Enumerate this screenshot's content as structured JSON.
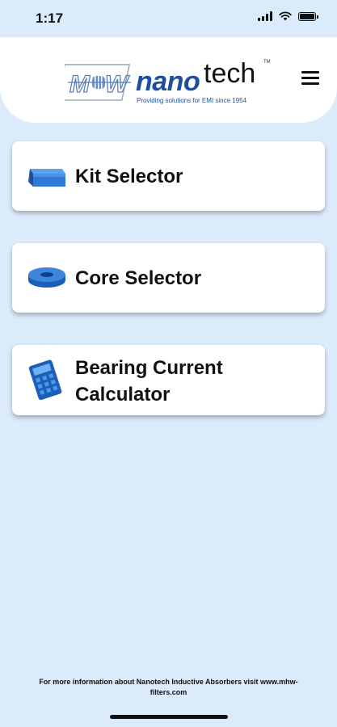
{
  "status_bar": {
    "time": "1:17"
  },
  "header": {
    "logo_mark": "M-H-W",
    "logo_nano": "nano",
    "logo_tech": "tech",
    "logo_tm": "TM",
    "tagline": "Providing solutions for EMI since 1954",
    "menu_icon": "hamburger-icon"
  },
  "buttons": [
    {
      "label": "Kit Selector",
      "icon": "kit-box-icon"
    },
    {
      "label": "Core Selector",
      "icon": "toroid-core-icon"
    },
    {
      "label_line1": "Bearing Current",
      "label_line2": "Calculator",
      "icon": "calculator-icon"
    }
  ],
  "footer": {
    "line1": "For more information about Nanotech Inductive Absorbers visit www.mhw-",
    "line2": "filters.com"
  },
  "colors": {
    "background": "#dcebfb",
    "brand_blue": "#1d4f9e",
    "icon_blue": "#2f79d6"
  }
}
